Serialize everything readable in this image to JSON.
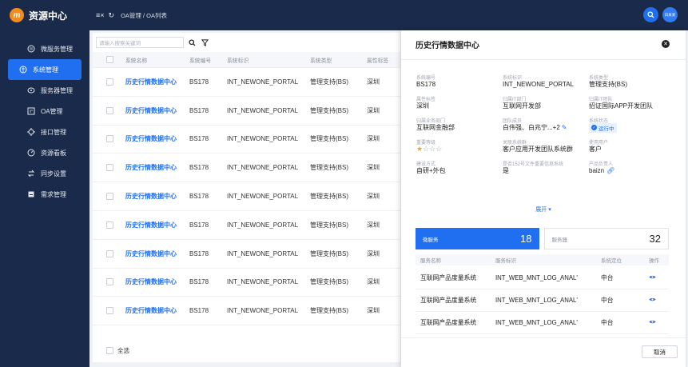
{
  "brand": {
    "logo_text": "m",
    "title": "资源中心"
  },
  "sidebar": {
    "items": [
      {
        "label": "微服务管理",
        "icon": "microservice-icon"
      },
      {
        "label": "系统管理",
        "icon": "system-icon",
        "active": true
      },
      {
        "label": "服务器管理",
        "icon": "server-icon"
      },
      {
        "label": "OA管理",
        "icon": "oa-icon"
      },
      {
        "label": "接口管理",
        "icon": "api-icon"
      },
      {
        "label": "资源看板",
        "icon": "dashboard-icon"
      },
      {
        "label": "同步设置",
        "icon": "sync-icon"
      },
      {
        "label": "需求管理",
        "icon": "requirement-icon"
      }
    ]
  },
  "header": {
    "collapse_glyph": "≡×",
    "refresh_glyph": "↻",
    "breadcrumb": "OA管理 / OA列表",
    "avatar_text": "白某某"
  },
  "toolbar": {
    "search_placeholder": "请输入搜索关键词"
  },
  "table": {
    "columns": [
      "系统名称",
      "系统编号",
      "系统标识",
      "系统类型",
      "属性标签"
    ],
    "rows": [
      [
        "历史行情数据中心",
        "BS178",
        "INT_NEWONE_PORTAL",
        "管理支持(BS)",
        "深圳"
      ],
      [
        "历史行情数据中心",
        "BS178",
        "INT_NEWONE_PORTAL",
        "管理支持(BS)",
        "深圳"
      ],
      [
        "历史行情数据中心",
        "BS178",
        "INT_NEWONE_PORTAL",
        "管理支持(BS)",
        "深圳"
      ],
      [
        "历史行情数据中心",
        "BS178",
        "INT_NEWONE_PORTAL",
        "管理支持(BS)",
        "深圳"
      ],
      [
        "历史行情数据中心",
        "BS178",
        "INT_NEWONE_PORTAL",
        "管理支持(BS)",
        "深圳"
      ],
      [
        "历史行情数据中心",
        "BS178",
        "INT_NEWONE_PORTAL",
        "管理支持(BS)",
        "深圳"
      ],
      [
        "历史行情数据中心",
        "BS178",
        "INT_NEWONE_PORTAL",
        "管理支持(BS)",
        "深圳"
      ],
      [
        "历史行情数据中心",
        "BS178",
        "INT_NEWONE_PORTAL",
        "管理支持(BS)",
        "深圳"
      ],
      [
        "历史行情数据中心",
        "BS178",
        "INT_NEWONE_PORTAL",
        "管理支持(BS)",
        "深圳"
      ]
    ],
    "select_all_label": "全选"
  },
  "drawer": {
    "title": "历史行情数据中心",
    "fields": [
      {
        "label": "系统编号",
        "value": "BS178"
      },
      {
        "label": "系统标识",
        "value": "INT_NEWONE_PORTAL"
      },
      {
        "label": "系统类型",
        "value": "管理支持(BS)"
      },
      {
        "label": "属性标签",
        "value": "深圳"
      },
      {
        "label": "归属IT部门",
        "value": "互联网开发部"
      },
      {
        "label": "归属IT团队",
        "value": "招证国际APP开发团队"
      },
      {
        "label": "归属业务部门",
        "value": "互联网金融部"
      },
      {
        "label": "团队成员",
        "value": "白伟强、白兆宁...+2"
      },
      {
        "label": "系统状态",
        "value": "运行中"
      },
      {
        "label": "重要等级",
        "value": ""
      },
      {
        "label": "关联系统群",
        "value": "客户应用开发团队系统群"
      },
      {
        "label": "使用用户",
        "value": "客户"
      },
      {
        "label": "建设方式",
        "value": "自研+外包"
      },
      {
        "label": "是否152号文件重要信息系统",
        "value": "是"
      },
      {
        "label": "产品负责人",
        "value": "baizn"
      }
    ],
    "importance_stars": 1,
    "importance_max": 4,
    "expand_label": "展开 ▾",
    "stats": [
      {
        "label": "微服务",
        "count": "18"
      },
      {
        "label": "服务器",
        "count": "32"
      }
    ],
    "sub_columns": [
      "服务名称",
      "服务标识",
      "系统定位",
      "操作"
    ],
    "sub_rows": [
      [
        "互联网产品度量系统",
        "INT_WEB_MNT_LOG_ANAL'",
        "中台"
      ],
      [
        "互联网产品度量系统",
        "INT_WEB_MNT_LOG_ANAL'",
        "中台"
      ],
      [
        "互联网产品度量系统",
        "INT_WEB_MNT_LOG_ANAL'",
        "中台"
      ]
    ],
    "cancel_label": "取消"
  },
  "colors": {
    "primary": "#1f6ff0",
    "sidebar_bg": "#1a2a4a",
    "star": "#f5a623"
  }
}
